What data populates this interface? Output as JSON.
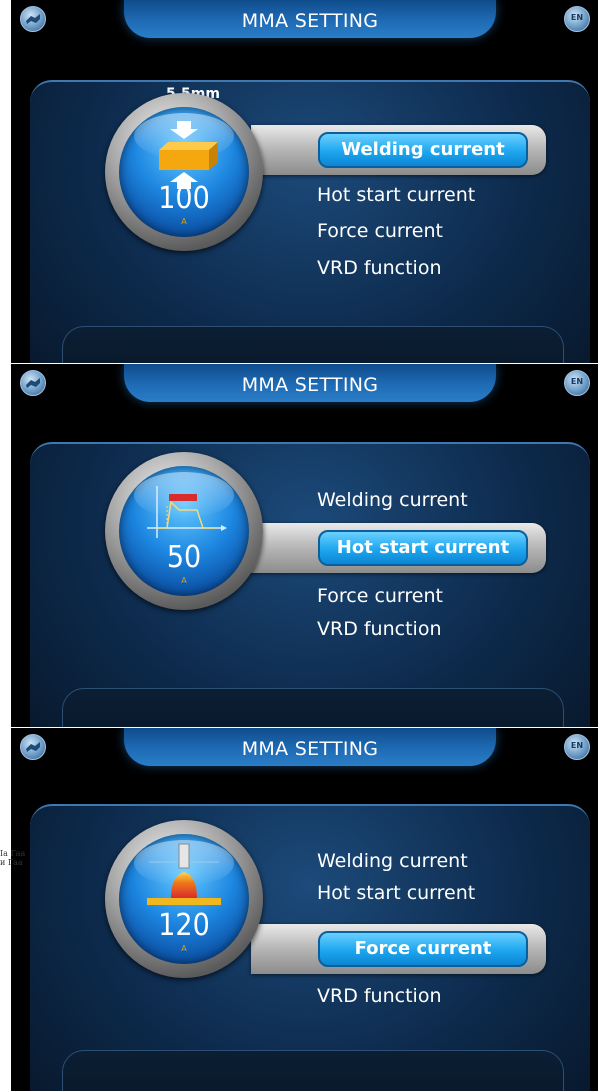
{
  "screens": [
    {
      "title": "MMA SETTING",
      "lang": "EN",
      "thickness": "5.5mm",
      "value": "100",
      "unit": "A",
      "icon": "plate-thickness-icon",
      "menu": [
        "Welding current",
        "Hot start current",
        "Force current",
        "VRD function"
      ],
      "selected": 0
    },
    {
      "title": "MMA SETTING",
      "lang": "EN",
      "value": "50",
      "unit": "A",
      "icon": "hot-start-graph-icon",
      "menu": [
        "Welding current",
        "Hot start current",
        "Force current",
        "VRD function"
      ],
      "selected": 1
    },
    {
      "title": "MMA SETTING",
      "lang": "EN",
      "value": "120",
      "unit": "A",
      "icon": "arc-force-icon",
      "menu": [
        "Welding current",
        "Hot start current",
        "Force current",
        "VRD function"
      ],
      "selected": 2
    }
  ],
  "stray_text": "Ia Гаа\nи Гаа",
  "colors": {
    "accent": "#1da6ee",
    "background": "#000000",
    "highlight_bar": "#d92c2c"
  }
}
